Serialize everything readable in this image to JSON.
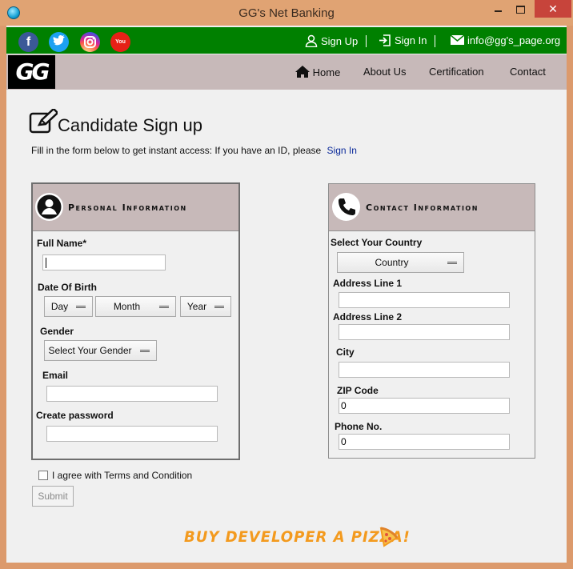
{
  "window": {
    "title": "GG's Net Banking",
    "close_glyph": "✕"
  },
  "topbar": {
    "social": [
      {
        "name": "facebook-icon",
        "glyph": "f"
      },
      {
        "name": "twitter-icon",
        "glyph": "t"
      },
      {
        "name": "instagram-icon",
        "glyph": "◎"
      },
      {
        "name": "youtube-icon",
        "glyph": "You"
      }
    ],
    "signup_label": "Sign Up",
    "signin_label": "Sign In",
    "email": "info@gg's_page.org"
  },
  "nav": {
    "logo": "GG",
    "items": [
      "Home",
      "About Us",
      "Certification",
      "Contact"
    ]
  },
  "page": {
    "title": "Candidate Sign up",
    "subtitle": "Fill in the form below to get instant access: If you have an ID, please",
    "subtitle_link": "Sign In"
  },
  "personal": {
    "heading": "Personal Information",
    "full_name_label": "Full Name*",
    "full_name_value": "",
    "dob_label": "Date Of Birth",
    "day": "Day",
    "month": "Month",
    "year": "Year",
    "gender_label": "Gender",
    "gender_value": "Select Your Gender",
    "email_label": "Email",
    "email_value": "",
    "password_label": "Create password",
    "password_value": ""
  },
  "contact": {
    "heading": "Contact Information",
    "country_label": "Select Your Country",
    "country_value": "Country",
    "address1_label": "Address Line 1",
    "address1_value": "",
    "address2_label": "Address Line 2",
    "address2_value": "",
    "city_label": "City",
    "city_value": "",
    "zip_label": "ZIP Code",
    "zip_value": "0",
    "phone_label": "Phone No.",
    "phone_value": "0"
  },
  "terms_label": "I agree with Terms and Condition",
  "terms_checked": false,
  "submit_label": "Submit",
  "footer_banner": "BUY DEVELOPER A PIZZA!",
  "colors": {
    "greenbar": "#008000",
    "navbar": "#c7b9b9",
    "accent": "#f39a1e",
    "link": "#0b2a9a"
  }
}
